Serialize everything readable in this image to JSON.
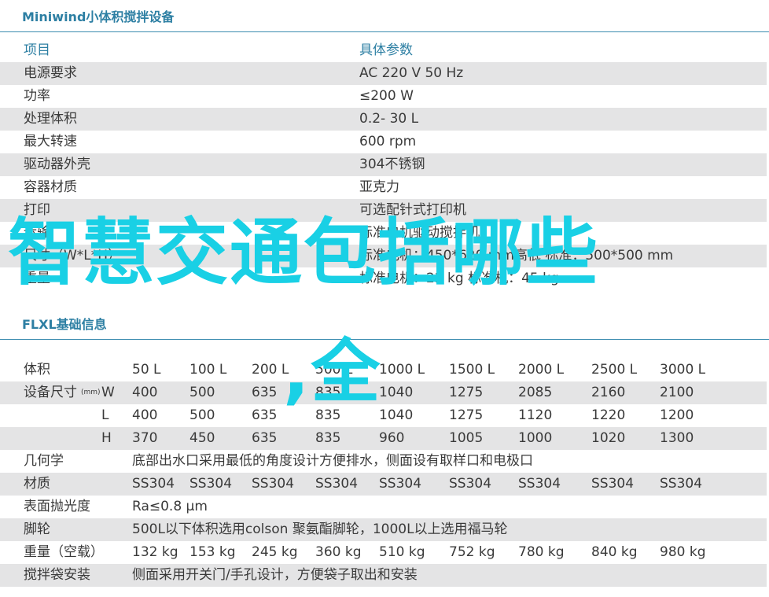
{
  "section1": {
    "title": "Miniwind小体积搅拌设备",
    "header": {
      "item": "项目",
      "param": "具体参数"
    },
    "rows": [
      {
        "item": "电源要求",
        "param": "AC 220  V 50 Hz"
      },
      {
        "item": "功率",
        "param": "≤200 W"
      },
      {
        "item": "处理体积",
        "param": "0.2- 30 L"
      },
      {
        "item": "最大转速",
        "param": "600  rpm"
      },
      {
        "item": "驱动器外壳",
        "param": "304不锈钢"
      },
      {
        "item": "容器材质",
        "param": "亚克力"
      },
      {
        "item": "打印",
        "param": "可选配针式打印机"
      },
      {
        "item": "运输",
        "param": "标准电机驱动搅拌机"
      },
      {
        "item": "尺寸（W*L*H）",
        "param": "标准电机：450*620 mm高低  标准：500*500 mm"
      },
      {
        "item": "重量",
        "param": "标准电机：22 kg  标准机：45 kg"
      }
    ]
  },
  "section2": {
    "title": "FLXL基础信息",
    "rows": [
      {
        "label": "体积",
        "values": [
          "50 L",
          "100 L",
          "200 L",
          "500 L",
          "1000 L",
          "1500 L",
          "2000 L",
          "2500 L",
          "3000 L"
        ]
      },
      {
        "label": "设备尺寸",
        "unit": "(mm)",
        "axis": "W",
        "values": [
          "400",
          "500",
          "635",
          "835",
          "1040",
          "1275",
          "2085",
          "2160",
          "2100"
        ]
      },
      {
        "axis": "L",
        "values": [
          "400",
          "500",
          "635",
          "835",
          "1040",
          "1275",
          "1120",
          "1220",
          "1200"
        ]
      },
      {
        "axis": "H",
        "values": [
          "370",
          "450",
          "635",
          "835",
          "960",
          "1005",
          "1000",
          "1020",
          "1300"
        ]
      },
      {
        "label": "几何学",
        "text": "底部出水口采用最低的角度设计方便排水，侧面设有取样口和电极口"
      },
      {
        "label": "材质",
        "values": [
          "SS304",
          "SS304",
          "SS304",
          "SS304",
          "SS304",
          "SS304",
          "SS304",
          "SS304",
          "SS304"
        ]
      },
      {
        "label": "表面抛光度",
        "text": "Ra≤0.8 μm"
      },
      {
        "label": "脚轮",
        "text": "500L以下体积选用colson 聚氨酯脚轮，1000L以上选用福马轮"
      },
      {
        "label": "重量（空载）",
        "values": [
          "132 kg",
          "153 kg",
          "245 kg",
          "360 kg",
          "510 kg",
          "752 kg",
          "780 kg",
          "840 kg",
          "980 kg"
        ]
      },
      {
        "label": "搅拌袋安装",
        "text": "侧面采用开关门/手孔设计，方便袋子取出和安装"
      }
    ]
  },
  "overlay": {
    "line1": "智慧交通包括哪些",
    "line2": ",全"
  }
}
